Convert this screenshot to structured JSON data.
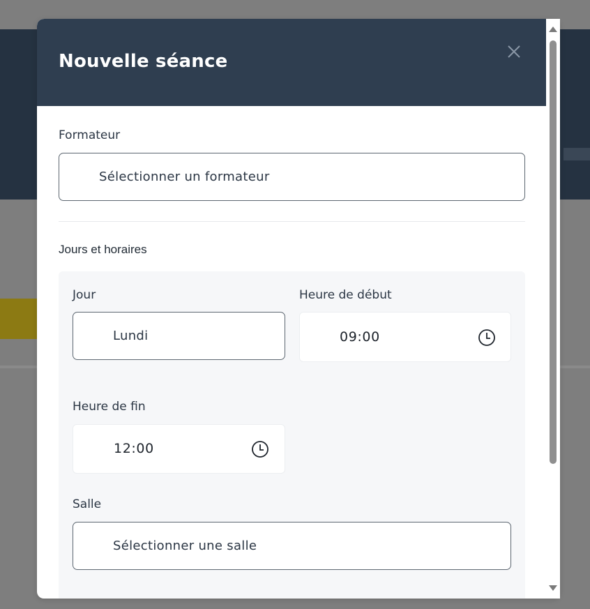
{
  "modal": {
    "title": "Nouvelle séance",
    "close_icon": "close-icon"
  },
  "formateur": {
    "label": "Formateur",
    "value": "Sélectionner un formateur"
  },
  "schedule": {
    "section_title": "Jours et horaires",
    "jour": {
      "label": "Jour",
      "value": "Lundi"
    },
    "heure_debut": {
      "label": "Heure de début",
      "value": "09:00",
      "icon": "clock-icon"
    },
    "heure_fin": {
      "label": "Heure de fin",
      "value": "12:00",
      "icon": "clock-icon"
    },
    "salle": {
      "label": "Salle",
      "value": "Sélectionner une salle"
    }
  },
  "colors": {
    "header_bg": "#2f3e50",
    "overlay": "#7e7e7e",
    "section_bg": "#f6f7f9"
  }
}
